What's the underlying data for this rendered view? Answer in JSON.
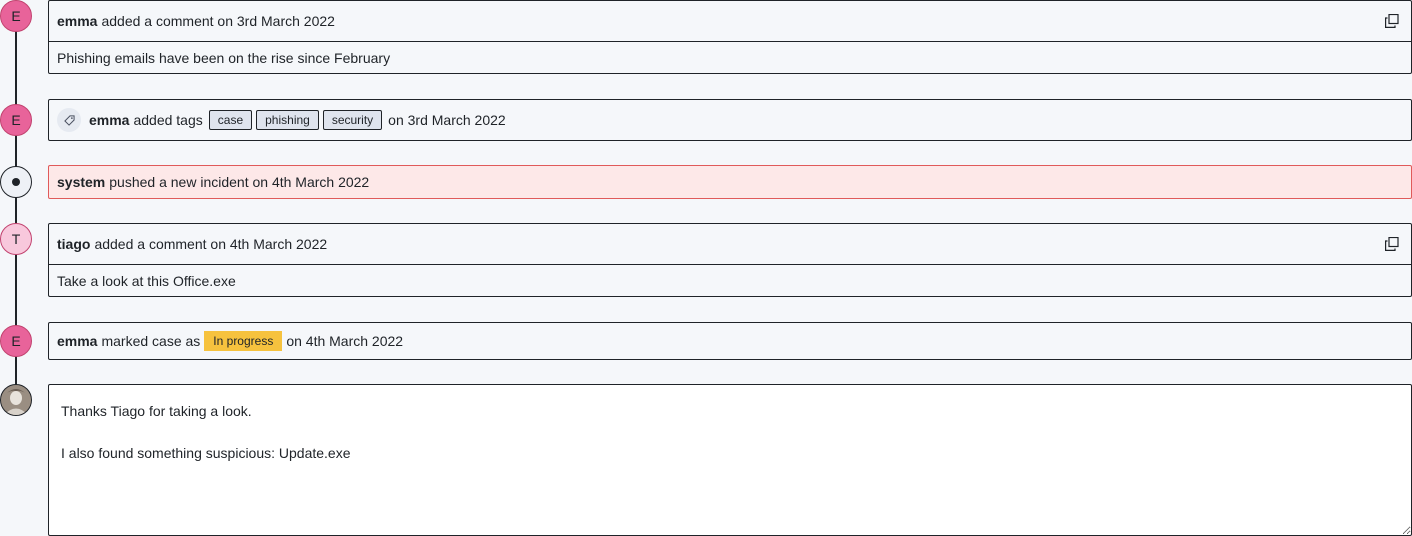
{
  "events": [
    {
      "avatar_letter": "E",
      "user": "emma",
      "action": "added a comment on 3rd March 2022",
      "comment": "Phishing emails have been on the rise since February"
    },
    {
      "avatar_letter": "E",
      "user": "emma",
      "action_pre": "added tags",
      "tags": [
        "case",
        "phishing",
        "security"
      ],
      "action_post": "on 3rd March 2022"
    },
    {
      "user": "system",
      "action": "pushed a new incident on 4th March 2022",
      "alert_color": "#fde8e8"
    },
    {
      "avatar_letter": "T",
      "user": "tiago",
      "action": "added a comment on 4th March 2022",
      "comment": "Take a look at this Office.exe"
    },
    {
      "avatar_letter": "E",
      "user": "emma",
      "action_pre": "marked case as",
      "status": "In progress",
      "status_color": "#f6c23e",
      "action_post": "on 4th March 2022"
    }
  ],
  "composer": {
    "value": "Thanks Tiago for taking a look.\n\nI also found something suspicious: Update.exe"
  },
  "icons": {
    "copy": "copy-icon",
    "tag": "tag-icon",
    "system": "system-dot-icon"
  }
}
